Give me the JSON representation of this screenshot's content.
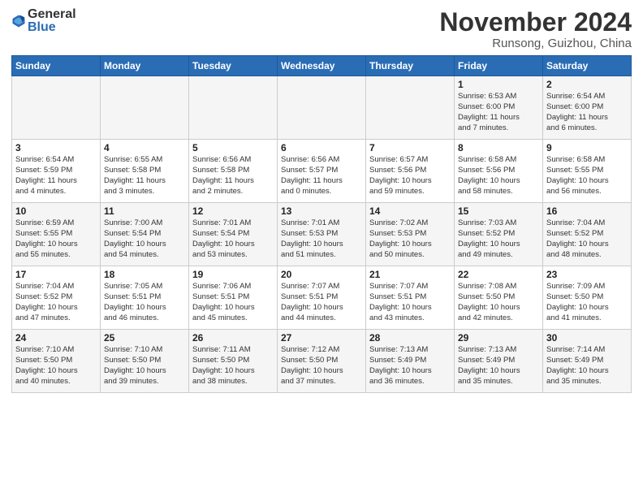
{
  "logo": {
    "general": "General",
    "blue": "Blue"
  },
  "header": {
    "month": "November 2024",
    "location": "Runsong, Guizhou, China"
  },
  "weekdays": [
    "Sunday",
    "Monday",
    "Tuesday",
    "Wednesday",
    "Thursday",
    "Friday",
    "Saturday"
  ],
  "weeks": [
    [
      {
        "day": "",
        "info": ""
      },
      {
        "day": "",
        "info": ""
      },
      {
        "day": "",
        "info": ""
      },
      {
        "day": "",
        "info": ""
      },
      {
        "day": "",
        "info": ""
      },
      {
        "day": "1",
        "info": "Sunrise: 6:53 AM\nSunset: 6:00 PM\nDaylight: 11 hours\nand 7 minutes."
      },
      {
        "day": "2",
        "info": "Sunrise: 6:54 AM\nSunset: 6:00 PM\nDaylight: 11 hours\nand 6 minutes."
      }
    ],
    [
      {
        "day": "3",
        "info": "Sunrise: 6:54 AM\nSunset: 5:59 PM\nDaylight: 11 hours\nand 4 minutes."
      },
      {
        "day": "4",
        "info": "Sunrise: 6:55 AM\nSunset: 5:58 PM\nDaylight: 11 hours\nand 3 minutes."
      },
      {
        "day": "5",
        "info": "Sunrise: 6:56 AM\nSunset: 5:58 PM\nDaylight: 11 hours\nand 2 minutes."
      },
      {
        "day": "6",
        "info": "Sunrise: 6:56 AM\nSunset: 5:57 PM\nDaylight: 11 hours\nand 0 minutes."
      },
      {
        "day": "7",
        "info": "Sunrise: 6:57 AM\nSunset: 5:56 PM\nDaylight: 10 hours\nand 59 minutes."
      },
      {
        "day": "8",
        "info": "Sunrise: 6:58 AM\nSunset: 5:56 PM\nDaylight: 10 hours\nand 58 minutes."
      },
      {
        "day": "9",
        "info": "Sunrise: 6:58 AM\nSunset: 5:55 PM\nDaylight: 10 hours\nand 56 minutes."
      }
    ],
    [
      {
        "day": "10",
        "info": "Sunrise: 6:59 AM\nSunset: 5:55 PM\nDaylight: 10 hours\nand 55 minutes."
      },
      {
        "day": "11",
        "info": "Sunrise: 7:00 AM\nSunset: 5:54 PM\nDaylight: 10 hours\nand 54 minutes."
      },
      {
        "day": "12",
        "info": "Sunrise: 7:01 AM\nSunset: 5:54 PM\nDaylight: 10 hours\nand 53 minutes."
      },
      {
        "day": "13",
        "info": "Sunrise: 7:01 AM\nSunset: 5:53 PM\nDaylight: 10 hours\nand 51 minutes."
      },
      {
        "day": "14",
        "info": "Sunrise: 7:02 AM\nSunset: 5:53 PM\nDaylight: 10 hours\nand 50 minutes."
      },
      {
        "day": "15",
        "info": "Sunrise: 7:03 AM\nSunset: 5:52 PM\nDaylight: 10 hours\nand 49 minutes."
      },
      {
        "day": "16",
        "info": "Sunrise: 7:04 AM\nSunset: 5:52 PM\nDaylight: 10 hours\nand 48 minutes."
      }
    ],
    [
      {
        "day": "17",
        "info": "Sunrise: 7:04 AM\nSunset: 5:52 PM\nDaylight: 10 hours\nand 47 minutes."
      },
      {
        "day": "18",
        "info": "Sunrise: 7:05 AM\nSunset: 5:51 PM\nDaylight: 10 hours\nand 46 minutes."
      },
      {
        "day": "19",
        "info": "Sunrise: 7:06 AM\nSunset: 5:51 PM\nDaylight: 10 hours\nand 45 minutes."
      },
      {
        "day": "20",
        "info": "Sunrise: 7:07 AM\nSunset: 5:51 PM\nDaylight: 10 hours\nand 44 minutes."
      },
      {
        "day": "21",
        "info": "Sunrise: 7:07 AM\nSunset: 5:51 PM\nDaylight: 10 hours\nand 43 minutes."
      },
      {
        "day": "22",
        "info": "Sunrise: 7:08 AM\nSunset: 5:50 PM\nDaylight: 10 hours\nand 42 minutes."
      },
      {
        "day": "23",
        "info": "Sunrise: 7:09 AM\nSunset: 5:50 PM\nDaylight: 10 hours\nand 41 minutes."
      }
    ],
    [
      {
        "day": "24",
        "info": "Sunrise: 7:10 AM\nSunset: 5:50 PM\nDaylight: 10 hours\nand 40 minutes."
      },
      {
        "day": "25",
        "info": "Sunrise: 7:10 AM\nSunset: 5:50 PM\nDaylight: 10 hours\nand 39 minutes."
      },
      {
        "day": "26",
        "info": "Sunrise: 7:11 AM\nSunset: 5:50 PM\nDaylight: 10 hours\nand 38 minutes."
      },
      {
        "day": "27",
        "info": "Sunrise: 7:12 AM\nSunset: 5:50 PM\nDaylight: 10 hours\nand 37 minutes."
      },
      {
        "day": "28",
        "info": "Sunrise: 7:13 AM\nSunset: 5:49 PM\nDaylight: 10 hours\nand 36 minutes."
      },
      {
        "day": "29",
        "info": "Sunrise: 7:13 AM\nSunset: 5:49 PM\nDaylight: 10 hours\nand 35 minutes."
      },
      {
        "day": "30",
        "info": "Sunrise: 7:14 AM\nSunset: 5:49 PM\nDaylight: 10 hours\nand 35 minutes."
      }
    ]
  ]
}
